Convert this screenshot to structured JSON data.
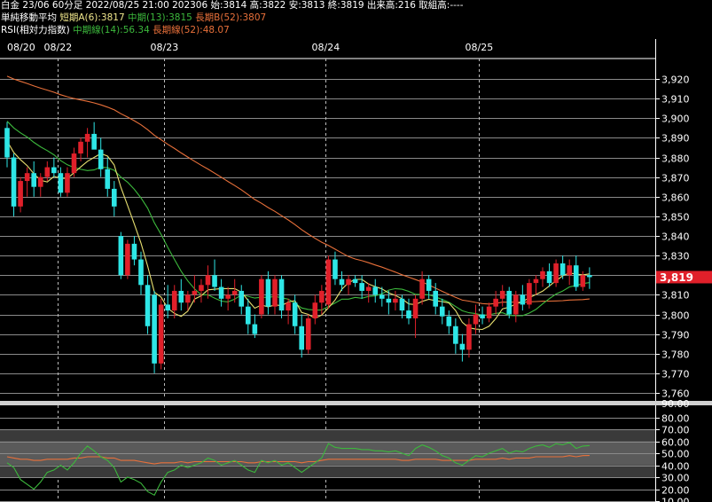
{
  "header": {
    "quote_line": "白金 23/06 60分足 2022/08/25 21:00 202306 始:3814 高:3822 安:3813 終:3819 出来高:216 取組高:----",
    "ma_title": "単純移動平均",
    "ma_short": "短期A(6):3817",
    "ma_mid": "中期(13):3815",
    "ma_long": "長期B(52):3807",
    "rsi_title": "RSI(相対力指数)",
    "rsi_mid": "中期線(14):56.34",
    "rsi_long": "長期線(52):48.07"
  },
  "colors": {
    "up": "#e0202a",
    "down": "#2ee6e6",
    "ma6": "#e8e070",
    "ma13": "#3cb83c",
    "ma52": "#e8703a",
    "rsi14": "#3cb83c",
    "rsi52": "#e8703a",
    "last_price_bg": "#e0202a"
  },
  "chart_data": {
    "type": "candlestick",
    "date_labels": [
      {
        "label": "08/20",
        "index": 0
      },
      {
        "label": "08/22",
        "index": 8
      },
      {
        "label": "08/23",
        "index": 24
      },
      {
        "label": "08/24",
        "index": 48
      },
      {
        "label": "08/25",
        "index": 71
      }
    ],
    "price_axis": {
      "ylim": [
        3755,
        3930
      ],
      "ticks": [
        3760,
        3770,
        3780,
        3790,
        3800,
        3810,
        3820,
        3830,
        3840,
        3850,
        3860,
        3870,
        3880,
        3890,
        3900,
        3910,
        3920
      ]
    },
    "last_price": "3,819",
    "candles": [
      [
        3895,
        3898,
        3875,
        3880
      ],
      [
        3880,
        3882,
        3850,
        3855
      ],
      [
        3855,
        3870,
        3852,
        3868
      ],
      [
        3868,
        3875,
        3860,
        3872
      ],
      [
        3872,
        3878,
        3860,
        3865
      ],
      [
        3865,
        3872,
        3860,
        3870
      ],
      [
        3870,
        3878,
        3868,
        3875
      ],
      [
        3875,
        3880,
        3870,
        3872
      ],
      [
        3872,
        3875,
        3860,
        3862
      ],
      [
        3862,
        3875,
        3860,
        3872
      ],
      [
        3872,
        3885,
        3870,
        3882
      ],
      [
        3882,
        3890,
        3878,
        3888
      ],
      [
        3888,
        3895,
        3880,
        3892
      ],
      [
        3892,
        3898,
        3888,
        3884
      ],
      [
        3884,
        3890,
        3870,
        3874
      ],
      [
        3874,
        3880,
        3860,
        3864
      ],
      [
        3864,
        3868,
        3850,
        3855
      ],
      [
        3840,
        3842,
        3818,
        3820
      ],
      [
        3820,
        3838,
        3818,
        3836
      ],
      [
        3836,
        3840,
        3825,
        3828
      ],
      [
        3828,
        3832,
        3810,
        3815
      ],
      [
        3815,
        3820,
        3790,
        3794
      ],
      [
        3810,
        3812,
        3770,
        3775
      ],
      [
        3775,
        3808,
        3772,
        3805
      ],
      [
        3805,
        3815,
        3798,
        3802
      ],
      [
        3802,
        3815,
        3798,
        3812
      ],
      [
        3812,
        3818,
        3802,
        3806
      ],
      [
        3806,
        3812,
        3802,
        3810
      ],
      [
        3810,
        3820,
        3806,
        3812
      ],
      [
        3812,
        3818,
        3806,
        3815
      ],
      [
        3815,
        3825,
        3808,
        3820
      ],
      [
        3820,
        3828,
        3812,
        3814
      ],
      [
        3814,
        3818,
        3804,
        3808
      ],
      [
        3808,
        3814,
        3802,
        3810
      ],
      [
        3810,
        3818,
        3806,
        3812
      ],
      [
        3812,
        3815,
        3800,
        3804
      ],
      [
        3804,
        3808,
        3790,
        3795
      ],
      [
        3795,
        3800,
        3788,
        3790
      ],
      [
        3800,
        3820,
        3798,
        3818
      ],
      [
        3818,
        3822,
        3800,
        3804
      ],
      [
        3804,
        3820,
        3800,
        3818
      ],
      [
        3818,
        3820,
        3798,
        3802
      ],
      [
        3802,
        3808,
        3795,
        3806
      ],
      [
        3806,
        3810,
        3790,
        3794
      ],
      [
        3794,
        3800,
        3778,
        3782
      ],
      [
        3782,
        3800,
        3780,
        3798
      ],
      [
        3798,
        3810,
        3795,
        3806
      ],
      [
        3806,
        3815,
        3800,
        3812
      ],
      [
        3805,
        3830,
        3803,
        3828
      ],
      [
        3828,
        3832,
        3815,
        3818
      ],
      [
        3818,
        3822,
        3812,
        3815
      ],
      [
        3815,
        3820,
        3810,
        3818
      ],
      [
        3818,
        3820,
        3814,
        3816
      ],
      [
        3816,
        3820,
        3808,
        3812
      ],
      [
        3812,
        3816,
        3806,
        3814
      ],
      [
        3814,
        3818,
        3806,
        3810
      ],
      [
        3810,
        3814,
        3804,
        3808
      ],
      [
        3808,
        3812,
        3800,
        3806
      ],
      [
        3806,
        3812,
        3802,
        3808
      ],
      [
        3808,
        3810,
        3798,
        3802
      ],
      [
        3802,
        3808,
        3795,
        3798
      ],
      [
        3798,
        3810,
        3788,
        3808
      ],
      [
        3808,
        3822,
        3805,
        3818
      ],
      [
        3818,
        3820,
        3808,
        3812
      ],
      [
        3812,
        3816,
        3800,
        3804
      ],
      [
        3804,
        3808,
        3795,
        3799
      ],
      [
        3799,
        3802,
        3790,
        3794
      ],
      [
        3794,
        3798,
        3780,
        3785
      ],
      [
        3785,
        3790,
        3776,
        3782
      ],
      [
        3782,
        3798,
        3778,
        3795
      ],
      [
        3795,
        3805,
        3790,
        3800
      ],
      [
        3800,
        3804,
        3795,
        3798
      ],
      [
        3798,
        3806,
        3796,
        3804
      ],
      [
        3804,
        3812,
        3800,
        3808
      ],
      [
        3808,
        3815,
        3804,
        3812
      ],
      [
        3812,
        3814,
        3798,
        3800
      ],
      [
        3800,
        3812,
        3796,
        3810
      ],
      [
        3810,
        3815,
        3802,
        3805
      ],
      [
        3805,
        3818,
        3803,
        3816
      ],
      [
        3816,
        3820,
        3810,
        3818
      ],
      [
        3818,
        3824,
        3814,
        3822
      ],
      [
        3822,
        3826,
        3814,
        3816
      ],
      [
        3816,
        3828,
        3814,
        3826
      ],
      [
        3826,
        3830,
        3818,
        3820
      ],
      [
        3820,
        3828,
        3815,
        3825
      ],
      [
        3825,
        3830,
        3812,
        3814
      ],
      [
        3814,
        3822,
        3812,
        3820
      ],
      [
        3820,
        3824,
        3813,
        3819
      ]
    ],
    "rsi_axis": {
      "ylim": [
        10,
        90
      ],
      "ticks": [
        10,
        20,
        30,
        40,
        50,
        60,
        70,
        80
      ],
      "top_label": "90.00"
    },
    "rsi14": [
      42,
      38,
      28,
      24,
      20,
      26,
      34,
      36,
      40,
      36,
      42,
      50,
      56,
      52,
      47,
      44,
      38,
      26,
      30,
      28,
      25,
      18,
      15,
      26,
      34,
      36,
      40,
      38,
      40,
      42,
      46,
      44,
      40,
      42,
      44,
      40,
      36,
      34,
      44,
      42,
      44,
      40,
      42,
      38,
      34,
      38,
      42,
      46,
      58,
      55,
      54,
      54,
      54,
      53,
      53,
      52,
      52,
      51,
      52,
      50,
      48,
      54,
      57,
      55,
      52,
      48,
      46,
      42,
      40,
      44,
      48,
      47,
      50,
      52,
      54,
      50,
      52,
      51,
      54,
      56,
      57,
      55,
      58,
      57,
      59,
      54,
      56,
      56.34
    ],
    "rsi52": [
      47,
      46,
      45,
      45,
      44,
      44,
      45,
      45,
      45,
      45,
      46,
      46,
      47,
      47,
      47,
      46,
      46,
      44,
      44,
      44,
      43,
      42,
      41,
      42,
      42,
      42,
      43,
      42,
      43,
      43,
      43,
      43,
      43,
      43,
      43,
      43,
      42,
      42,
      43,
      43,
      43,
      43,
      43,
      43,
      42,
      43,
      43,
      44,
      45,
      45,
      45,
      45,
      45,
      45,
      45,
      45,
      45,
      45,
      45,
      44,
      44,
      45,
      45,
      45,
      45,
      44,
      44,
      44,
      44,
      44,
      45,
      45,
      45,
      45,
      46,
      45,
      46,
      46,
      46,
      47,
      47,
      47,
      47,
      47,
      48,
      47,
      48,
      48.07
    ]
  }
}
